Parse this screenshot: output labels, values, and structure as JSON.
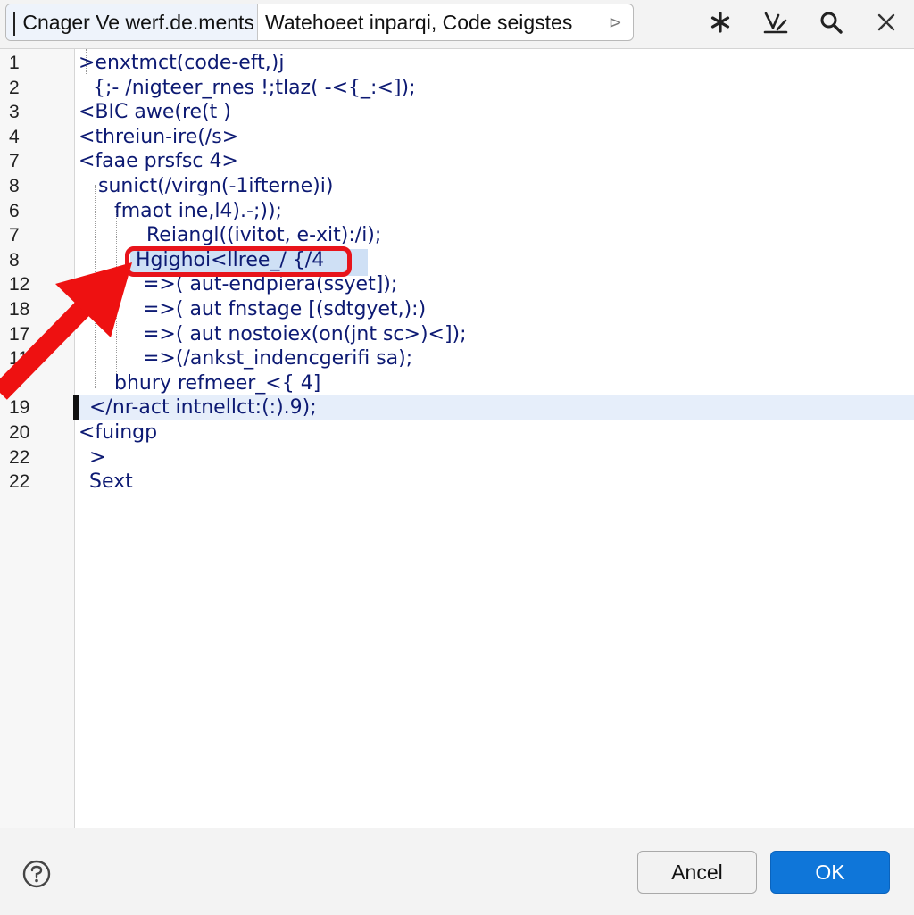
{
  "header": {
    "tabs": [
      {
        "label": "Cnager Ve werf.de.ments",
        "active": true
      },
      {
        "label": "Watehoeet inparqi, Code seigstes",
        "active": false
      }
    ],
    "tab_close_glyph": "⊳",
    "toolbar_icons": [
      "asterisk-icon",
      "sparkle-edit-icon",
      "search-icon",
      "close-icon"
    ]
  },
  "editor": {
    "current_line": 10,
    "highlighted_line": 8,
    "lines": [
      {
        "num": "1",
        "text": ">enxtmct(code-eft,)j"
      },
      {
        "num": "2",
        "text": "{;- /nigteer_rnes !;tlaz( -<{_:<]);"
      },
      {
        "num": "3",
        "text": "<BIC awe(re(t )"
      },
      {
        "num": "4",
        "text": "<threiun-ire(/s>"
      },
      {
        "num": "7",
        "text": "<faae prsfsc 4>"
      },
      {
        "num": "8",
        "text": "sunict(/virgn(-1ifterne)i)"
      },
      {
        "num": "6",
        "text": "fmaot ine,l4).-;));"
      },
      {
        "num": "7",
        "text": "Reiangl((ivitot, e-xit):/i);"
      },
      {
        "num": "8",
        "text": "Hgighoi<llree_/ {/4"
      },
      {
        "num": "12",
        "text": "=>( aut-endpiera(ssyet]);"
      },
      {
        "num": "18",
        "text": "=>( aut fnstage [(sdtgyet,):)"
      },
      {
        "num": "17",
        "text": "=>( aut nostoiex(on(jnt sc>)<]);"
      },
      {
        "num": "11",
        "text": "=>(/ankst_indencgerifi sa);"
      },
      {
        "num": "8",
        "text": "bhury refmeer_<{ 4]"
      },
      {
        "num": "19",
        "text": "</nr-act intnellct:(:).9);"
      },
      {
        "num": "20",
        "text": "<fuingp"
      },
      {
        "num": "22",
        "text": ">"
      },
      {
        "num": "22",
        "text": "Sext"
      }
    ]
  },
  "footer": {
    "help_icon": "help-icon",
    "cancel_label": "Ancel",
    "ok_label": "OK"
  },
  "colors": {
    "code_text": "#0d1a73",
    "current_line_bg": "#e6eefa",
    "annotation_red": "#e8141b",
    "ok_button": "#0f76d9"
  }
}
